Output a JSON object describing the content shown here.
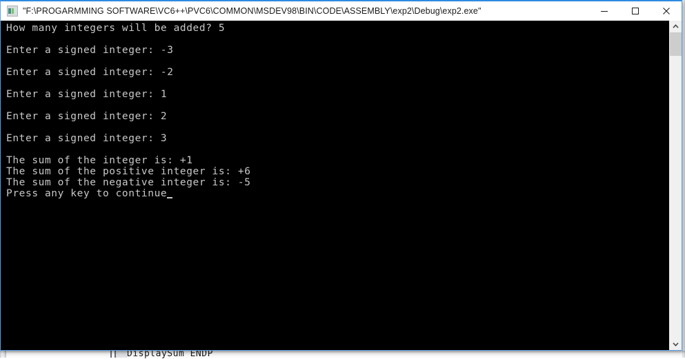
{
  "window": {
    "title": "\"F:\\PROGARMMING SOFTWARE\\VC6++\\PVC6\\COMMON\\MSDEV98\\BIN\\CODE\\ASSEMBLY\\exp2\\Debug\\exp2.exe\"",
    "icon": "console-window-icon",
    "controls": {
      "minimize": "—",
      "maximize": "□",
      "close": "✕"
    }
  },
  "console": {
    "background_color": "#000000",
    "text_color": "#c8c8c8",
    "lines": [
      "How many integers will be added? 5",
      "",
      "Enter a signed integer: -3",
      "",
      "Enter a signed integer: -2",
      "",
      "Enter a signed integer: 1",
      "",
      "Enter a signed integer: 2",
      "",
      "Enter a signed integer: 3",
      "",
      "The sum of the integer is: +1",
      "The sum of the positive integer is: +6",
      "The sum of the negative integer is: -5",
      "Press any key to continue"
    ],
    "cursor_after_line": "Press any key to continue",
    "scrollbar": {
      "up_arrow": "⌃",
      "down_arrow": "⌄"
    }
  },
  "background_ide": {
    "code_fragment": "DisplaySum ENDP"
  }
}
